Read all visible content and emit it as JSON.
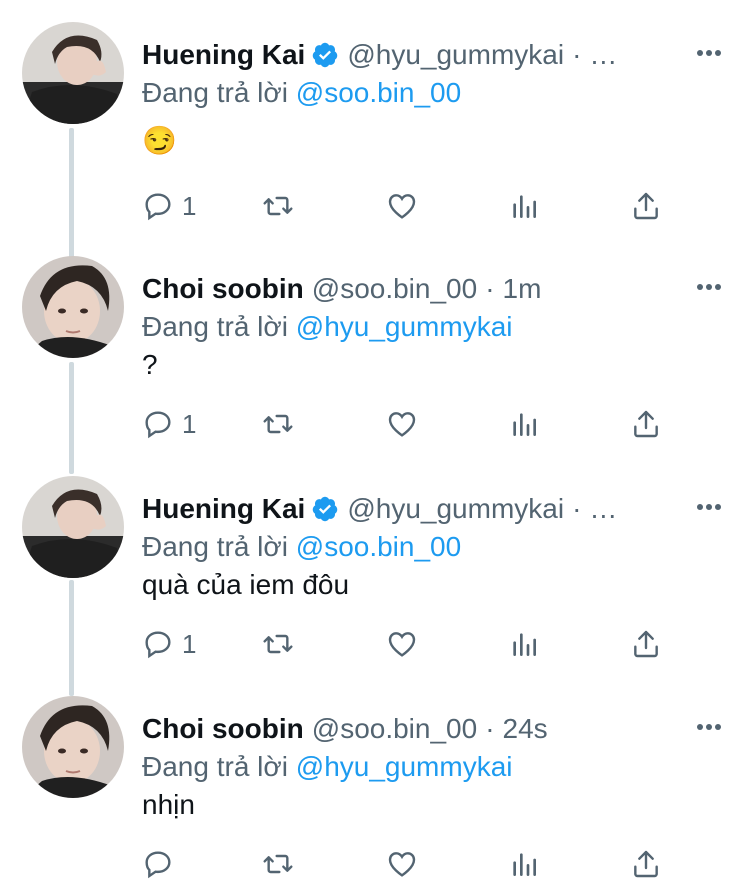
{
  "reply_prefix": "Đang trả lời",
  "colors": {
    "link": "#1d9bf0",
    "verified": "#1d9bf0",
    "secondary": "#536471",
    "thread_line": "#cfd9de"
  },
  "tweets": [
    {
      "name": "Huening Kai",
      "verified": true,
      "handle": "@hyu_gummykai",
      "separator": "·",
      "time": "…",
      "reply_to": "@soo.bin_00",
      "content": "😏",
      "reply_count": "1"
    },
    {
      "name": "Choi soobin",
      "verified": false,
      "handle": "@soo.bin_00",
      "separator": "·",
      "time": "1m",
      "reply_to": "@hyu_gummykai",
      "content": "?",
      "reply_count": "1"
    },
    {
      "name": "Huening Kai",
      "verified": true,
      "handle": "@hyu_gummykai",
      "separator": "·",
      "time": "…",
      "reply_to": "@soo.bin_00",
      "content": "quà của iem đôu",
      "reply_count": "1"
    },
    {
      "name": "Choi soobin",
      "verified": false,
      "handle": "@soo.bin_00",
      "separator": "·",
      "time": "24s",
      "reply_to": "@hyu_gummykai",
      "content": "nhịn",
      "reply_count": ""
    }
  ],
  "icons": {
    "more": "more-horizontal-icon",
    "reply": "reply-bubble-icon",
    "retweet": "retweet-icon",
    "like": "heart-icon",
    "analytics": "analytics-bars-icon",
    "share": "share-icon",
    "verified": "verified-badge-icon"
  }
}
